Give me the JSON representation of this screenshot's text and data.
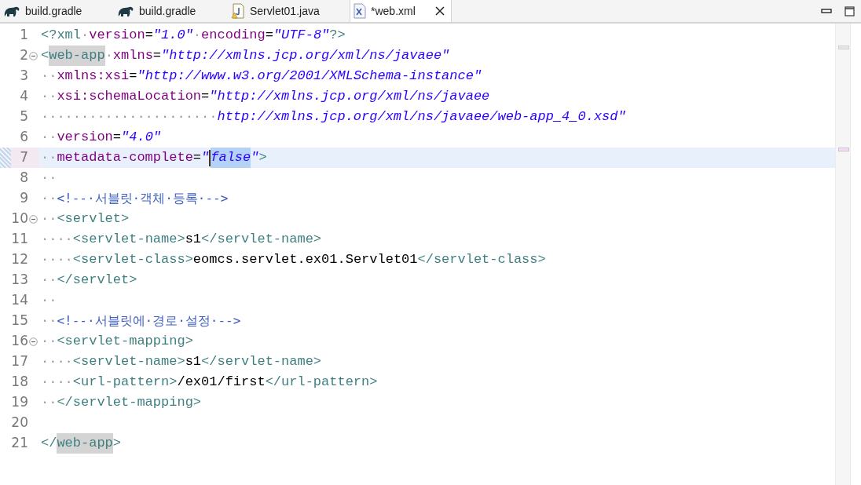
{
  "tabs": [
    {
      "kind": "gradle",
      "label": "build.gradle",
      "selected": false,
      "closable": false
    },
    {
      "kind": "gradle",
      "label": "build.gradle",
      "selected": false,
      "closable": false
    },
    {
      "kind": "java",
      "label": "Servlet01.java",
      "selected": false,
      "closable": false
    },
    {
      "kind": "xml",
      "label": "*web.xml",
      "selected": true,
      "closable": true
    }
  ],
  "lines": [
    {
      "number": "1",
      "foldable": false,
      "current": false,
      "changed": false,
      "tokens": [
        {
          "kind": "tag",
          "text": "<?xml"
        },
        {
          "kind": "ws",
          "text": "·"
        },
        {
          "kind": "attr",
          "text": "version"
        },
        {
          "kind": "text",
          "text": "="
        },
        {
          "kind": "value",
          "text": "\"1.0\""
        },
        {
          "kind": "ws",
          "text": "·"
        },
        {
          "kind": "attr",
          "text": "encoding"
        },
        {
          "kind": "text",
          "text": "="
        },
        {
          "kind": "value",
          "text": "\"UTF-8\""
        },
        {
          "kind": "tag",
          "text": "?>"
        }
      ]
    },
    {
      "number": "2",
      "foldable": true,
      "current": false,
      "changed": false,
      "ruler_mark": {
        "kind": "occurrence"
      },
      "tokens": [
        {
          "kind": "tag",
          "text": "<"
        },
        {
          "kind": "occurrence",
          "text": "web-app"
        },
        {
          "kind": "ws",
          "text": "·"
        },
        {
          "kind": "attr",
          "text": "xmlns"
        },
        {
          "kind": "text",
          "text": "="
        },
        {
          "kind": "value",
          "text": "\"http://xmlns.jcp.org/xml/ns/javaee\""
        }
      ]
    },
    {
      "number": "3",
      "foldable": false,
      "current": false,
      "changed": false,
      "tokens": [
        {
          "kind": "ws",
          "text": "··"
        },
        {
          "kind": "attr",
          "text": "xmlns:xsi"
        },
        {
          "kind": "text",
          "text": "="
        },
        {
          "kind": "value",
          "text": "\"http://www.w3.org/2001/XMLSchema-instance\""
        }
      ]
    },
    {
      "number": "4",
      "foldable": false,
      "current": false,
      "changed": false,
      "tokens": [
        {
          "kind": "ws",
          "text": "··"
        },
        {
          "kind": "attr",
          "text": "xsi:schemaLocation"
        },
        {
          "kind": "text",
          "text": "="
        },
        {
          "kind": "value",
          "text": "\"http://xmlns.jcp.org/xml/ns/javaee"
        }
      ]
    },
    {
      "number": "5",
      "foldable": false,
      "current": false,
      "changed": false,
      "tokens": [
        {
          "kind": "ws",
          "text": "······················"
        },
        {
          "kind": "value",
          "text": "http://xmlns.jcp.org/xml/ns/javaee/web-app_4_0.xsd\""
        }
      ]
    },
    {
      "number": "6",
      "foldable": false,
      "current": false,
      "changed": false,
      "tokens": [
        {
          "kind": "ws",
          "text": "··"
        },
        {
          "kind": "attr",
          "text": "version"
        },
        {
          "kind": "text",
          "text": "="
        },
        {
          "kind": "value",
          "text": "\"4.0\""
        }
      ]
    },
    {
      "number": "7",
      "foldable": false,
      "current": true,
      "changed": true,
      "ruler_mark": {
        "kind": "caret"
      },
      "tokens": [
        {
          "kind": "ws",
          "text": "··"
        },
        {
          "kind": "attr",
          "text": "metadata-complete"
        },
        {
          "kind": "text",
          "text": "="
        },
        {
          "kind": "value",
          "text": "\""
        },
        {
          "kind": "caret"
        },
        {
          "kind": "selection",
          "text": "false"
        },
        {
          "kind": "value",
          "text": "\""
        },
        {
          "kind": "tag",
          "text": ">"
        }
      ]
    },
    {
      "number": "8",
      "foldable": false,
      "current": false,
      "changed": false,
      "tokens": [
        {
          "kind": "ws",
          "text": "··"
        }
      ]
    },
    {
      "number": "9",
      "foldable": false,
      "current": false,
      "changed": false,
      "tokens": [
        {
          "kind": "ws",
          "text": "··"
        },
        {
          "kind": "comment",
          "text": "<!--·서블릿·객체·등록·-->"
        }
      ]
    },
    {
      "number": "10",
      "foldable": true,
      "current": false,
      "changed": false,
      "tokens": [
        {
          "kind": "ws",
          "text": "··"
        },
        {
          "kind": "tag",
          "text": "<servlet>"
        }
      ]
    },
    {
      "number": "11",
      "foldable": false,
      "current": false,
      "changed": false,
      "tokens": [
        {
          "kind": "ws",
          "text": "····"
        },
        {
          "kind": "tag",
          "text": "<servlet-name>"
        },
        {
          "kind": "text",
          "text": "s1"
        },
        {
          "kind": "tag",
          "text": "</servlet-name>"
        }
      ]
    },
    {
      "number": "12",
      "foldable": false,
      "current": false,
      "changed": false,
      "tokens": [
        {
          "kind": "ws",
          "text": "····"
        },
        {
          "kind": "tag",
          "text": "<servlet-class>"
        },
        {
          "kind": "text",
          "text": "eomcs.servlet.ex01.Servlet01"
        },
        {
          "kind": "tag",
          "text": "</servlet-class>"
        }
      ]
    },
    {
      "number": "13",
      "foldable": false,
      "current": false,
      "changed": false,
      "tokens": [
        {
          "kind": "ws",
          "text": "··"
        },
        {
          "kind": "tag",
          "text": "</servlet>"
        }
      ]
    },
    {
      "number": "14",
      "foldable": false,
      "current": false,
      "changed": false,
      "tokens": [
        {
          "kind": "ws",
          "text": "··"
        }
      ]
    },
    {
      "number": "15",
      "foldable": false,
      "current": false,
      "changed": false,
      "tokens": [
        {
          "kind": "ws",
          "text": "··"
        },
        {
          "kind": "comment",
          "text": "<!--·서블릿에·경로·설정·-->"
        }
      ]
    },
    {
      "number": "16",
      "foldable": true,
      "current": false,
      "changed": false,
      "tokens": [
        {
          "kind": "ws",
          "text": "··"
        },
        {
          "kind": "tag",
          "text": "<servlet-mapping>"
        }
      ]
    },
    {
      "number": "17",
      "foldable": false,
      "current": false,
      "changed": false,
      "tokens": [
        {
          "kind": "ws",
          "text": "····"
        },
        {
          "kind": "tag",
          "text": "<servlet-name>"
        },
        {
          "kind": "text",
          "text": "s1"
        },
        {
          "kind": "tag",
          "text": "</servlet-name>"
        }
      ]
    },
    {
      "number": "18",
      "foldable": false,
      "current": false,
      "changed": false,
      "tokens": [
        {
          "kind": "ws",
          "text": "····"
        },
        {
          "kind": "tag",
          "text": "<url-pattern>"
        },
        {
          "kind": "text",
          "text": "/ex01/first"
        },
        {
          "kind": "tag",
          "text": "</url-pattern>"
        }
      ]
    },
    {
      "number": "19",
      "foldable": false,
      "current": false,
      "changed": false,
      "tokens": [
        {
          "kind": "ws",
          "text": "··"
        },
        {
          "kind": "tag",
          "text": "</servlet-mapping>"
        }
      ]
    },
    {
      "number": "20",
      "foldable": false,
      "current": false,
      "changed": false
    },
    {
      "number": "21",
      "foldable": false,
      "current": false,
      "changed": false,
      "tokens": [
        {
          "kind": "tag",
          "text": "</"
        },
        {
          "kind": "occurrence",
          "text": "web-app"
        },
        {
          "kind": "tag",
          "text": ">"
        }
      ]
    }
  ]
}
